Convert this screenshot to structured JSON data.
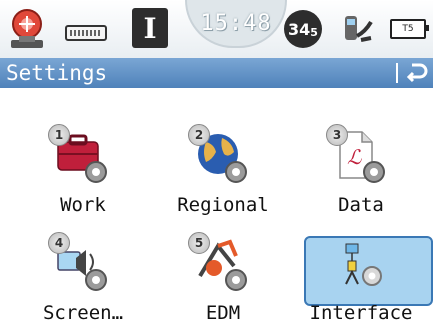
{
  "status": {
    "time": "15:48",
    "sat_count": "34",
    "sat_sub": "5",
    "battery_label": "T5"
  },
  "title": "Settings",
  "tiles": [
    {
      "number": "1",
      "label": "Work",
      "icon": "work-case-icon"
    },
    {
      "number": "2",
      "label": "Regional",
      "icon": "globe-icon"
    },
    {
      "number": "3",
      "label": "Data",
      "icon": "data-document-icon"
    },
    {
      "number": "4",
      "label": "Screen…",
      "icon": "screen-speaker-icon"
    },
    {
      "number": "5",
      "label": "EDM",
      "icon": "edm-prism-icon"
    },
    {
      "number": "",
      "label": "Interface",
      "icon": "interface-network-icon"
    }
  ],
  "selected_tile": "Interface",
  "colors": {
    "title_bar": "#4f82ba",
    "selection": "#a8d3f0"
  }
}
